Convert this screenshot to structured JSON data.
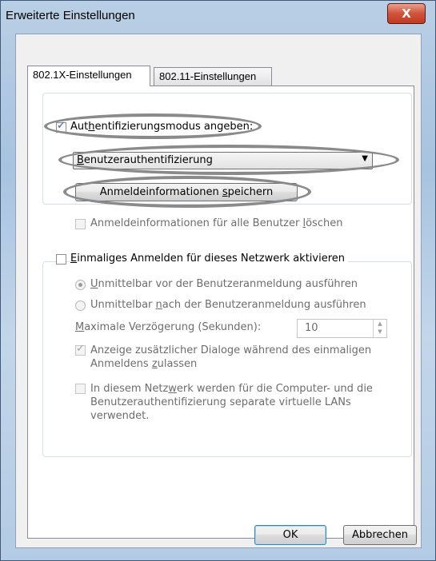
{
  "window": {
    "title": "Erweiterte Einstellungen",
    "close_glyph": "X"
  },
  "tabs": [
    {
      "label": "802.1X-Einstellungen",
      "active": true
    },
    {
      "label": "802.11-Einstellungen",
      "active": false
    }
  ],
  "auth_group": {
    "auth_mode_checkbox": {
      "pre": "Aut",
      "ul": "h",
      "post": "entifizierungsmodus angeben:",
      "checked": true
    },
    "auth_mode_select": {
      "pre": "",
      "ul": "B",
      "post": "enutzerauthentifizierung"
    },
    "save_credentials_button": {
      "pre": "Anmeldeinformationen ",
      "ul": "s",
      "post": "peichern"
    },
    "delete_credentials_checkbox": {
      "pre": "Anmeldeinformationen für alle Benutzer ",
      "ul": "l",
      "post": "öschen",
      "checked": false
    }
  },
  "sso_group": {
    "enable_checkbox": {
      "pre": "",
      "ul": "E",
      "post": "inmaliges Anmelden für dieses Netzwerk aktivieren",
      "checked": false
    },
    "radio_before": {
      "pre": "",
      "ul": "U",
      "post": "nmittelbar vor der Benutzeranmeldung ausführen",
      "selected": true
    },
    "radio_after": {
      "pre": "Unmittelbar ",
      "ul": "n",
      "post": "ach der Benutzeranmeldung ausführen",
      "selected": false
    },
    "max_delay": {
      "pre": "",
      "ul": "M",
      "post": "aximale Verzögerung (Sekunden):",
      "value": "10"
    },
    "show_dialogs_checkbox": {
      "line1": "Anzeige zusätzlicher Dialoge während des einmaligen",
      "line2_pre": "Anmeldens ",
      "line2_ul": "z",
      "line2_post": "ulassen",
      "checked": true
    },
    "separate_vlans_checkbox": {
      "line1_pre": "In diesem Netz",
      "line1_ul": "w",
      "line1_post": "erk werden für die Computer- und die",
      "line2": "Benutzerauthentifizierung separate virtuelle LANs",
      "line3": "verwendet.",
      "checked": false
    }
  },
  "footer": {
    "ok_label": "OK",
    "cancel_label": "Abbrechen"
  },
  "colors": {
    "annotation_ellipse": "#8a8a8a",
    "title_bar": "#b9cfe5",
    "close_button": "#c23a22"
  }
}
